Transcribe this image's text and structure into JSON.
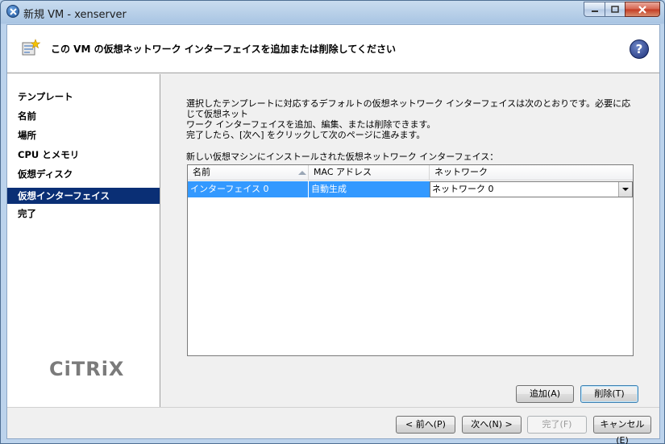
{
  "window": {
    "title": "新規 VM - xenserver"
  },
  "header": {
    "title": "この VM の仮想ネットワーク インターフェイスを追加または削除してください",
    "help_label": "?"
  },
  "nav": {
    "items": [
      {
        "label": "テンプレート"
      },
      {
        "label": "名前"
      },
      {
        "label": "場所"
      },
      {
        "label": "CPU とメモリ"
      },
      {
        "label": "仮想ディスク"
      },
      {
        "label": "仮想インターフェイス",
        "active": true
      },
      {
        "label": "完了"
      }
    ],
    "logo": "CiTRiX"
  },
  "main": {
    "desc_line1": "選択したテンプレートに対応するデフォルトの仮想ネットワーク インターフェイスは次のとおりです。必要に応じて仮想ネット",
    "desc_line2": "ワーク インターフェイスを追加、編集、または削除できます。",
    "desc_line3": "完了したら、[次へ] をクリックして次のページに進みます。",
    "list_label": "新しい仮想マシンにインストールされた仮想ネットワーク インターフェイス：",
    "grid": {
      "columns": [
        "名前",
        "MAC アドレス",
        "ネットワーク"
      ],
      "rows": [
        {
          "name": "インターフェイス 0",
          "mac": "自動生成",
          "network": "ネットワーク 0"
        }
      ]
    },
    "add_button": "追加(A)",
    "remove_button": "削除(T)"
  },
  "footer": {
    "back": "< 前へ(P)",
    "next": "次へ(N) >",
    "finish": "完了(F)",
    "cancel": "キャンセル(E)"
  },
  "colors": {
    "nav_active": "#0a2f75",
    "row_selected": "#3399ff"
  }
}
